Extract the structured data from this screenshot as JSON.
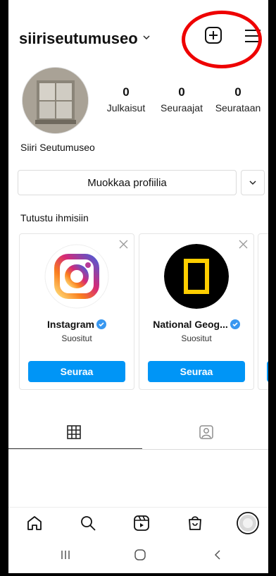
{
  "header": {
    "username": "siiriseutumuseo"
  },
  "profile": {
    "stats": [
      {
        "value": "0",
        "label": "Julkaisut"
      },
      {
        "value": "0",
        "label": "Seuraajat"
      },
      {
        "value": "0",
        "label": "Seurataan"
      }
    ],
    "full_name": "Siiri Seutumuseo",
    "edit_button_label": "Muokkaa profiilia"
  },
  "discover": {
    "title": "Tutustu ihmisiin",
    "cards": [
      {
        "name": "Instagram",
        "subtitle": "Suositut",
        "follow_label": "Seuraa",
        "verified": true
      },
      {
        "name": "National Geog...",
        "subtitle": "Suositut",
        "follow_label": "Seuraa",
        "verified": true
      }
    ]
  },
  "tabs": [
    {
      "icon": "grid-icon",
      "active": true
    },
    {
      "icon": "tagged-icon",
      "active": false
    }
  ],
  "bottom_nav": [
    {
      "icon": "home-icon"
    },
    {
      "icon": "search-icon"
    },
    {
      "icon": "reels-icon"
    },
    {
      "icon": "shop-icon"
    },
    {
      "icon": "profile-avatar-icon"
    }
  ],
  "system_nav": [
    {
      "icon": "recent-apps-icon"
    },
    {
      "icon": "home-button-icon"
    },
    {
      "icon": "back-icon"
    }
  ],
  "colors": {
    "accent": "#0095f6",
    "annotation_circle": "#e00000",
    "verified": "#3897f0"
  }
}
